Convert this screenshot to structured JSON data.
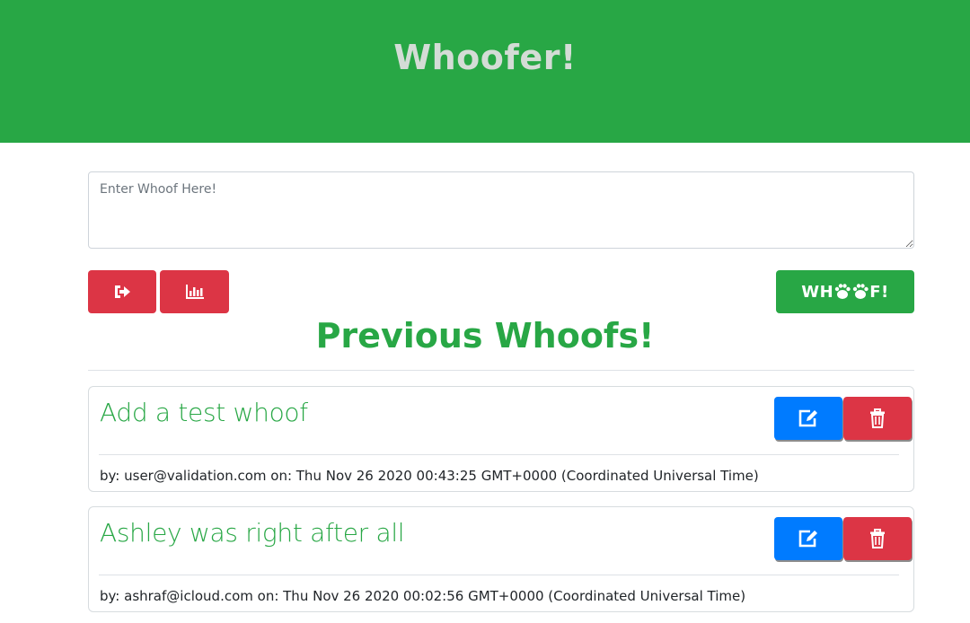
{
  "header": {
    "title": "Whoofer!"
  },
  "compose": {
    "placeholder": "Enter Whoof Here!",
    "value": ""
  },
  "toolbar": {
    "logout_icon": "sign-out-icon",
    "stats_icon": "bar-chart-icon",
    "whoof_label_left": "WH",
    "whoof_label_right": "F!",
    "whoof_icon": "paw-icon"
  },
  "section": {
    "title": "Previous Whoofs!"
  },
  "whoofs": [
    {
      "text": "Add a test whoof",
      "meta": "by: user@validation.com on: Thu Nov 26 2020 00:43:25 GMT+0000 (Coordinated Universal Time)"
    },
    {
      "text": "Ashley was right after all",
      "meta": "by: ashraf@icloud.com on: Thu Nov 26 2020 00:02:56 GMT+0000 (Coordinated Universal Time)"
    }
  ],
  "colors": {
    "primary_green": "#28a745",
    "danger_red": "#dc3545",
    "edit_blue": "#007bff"
  }
}
